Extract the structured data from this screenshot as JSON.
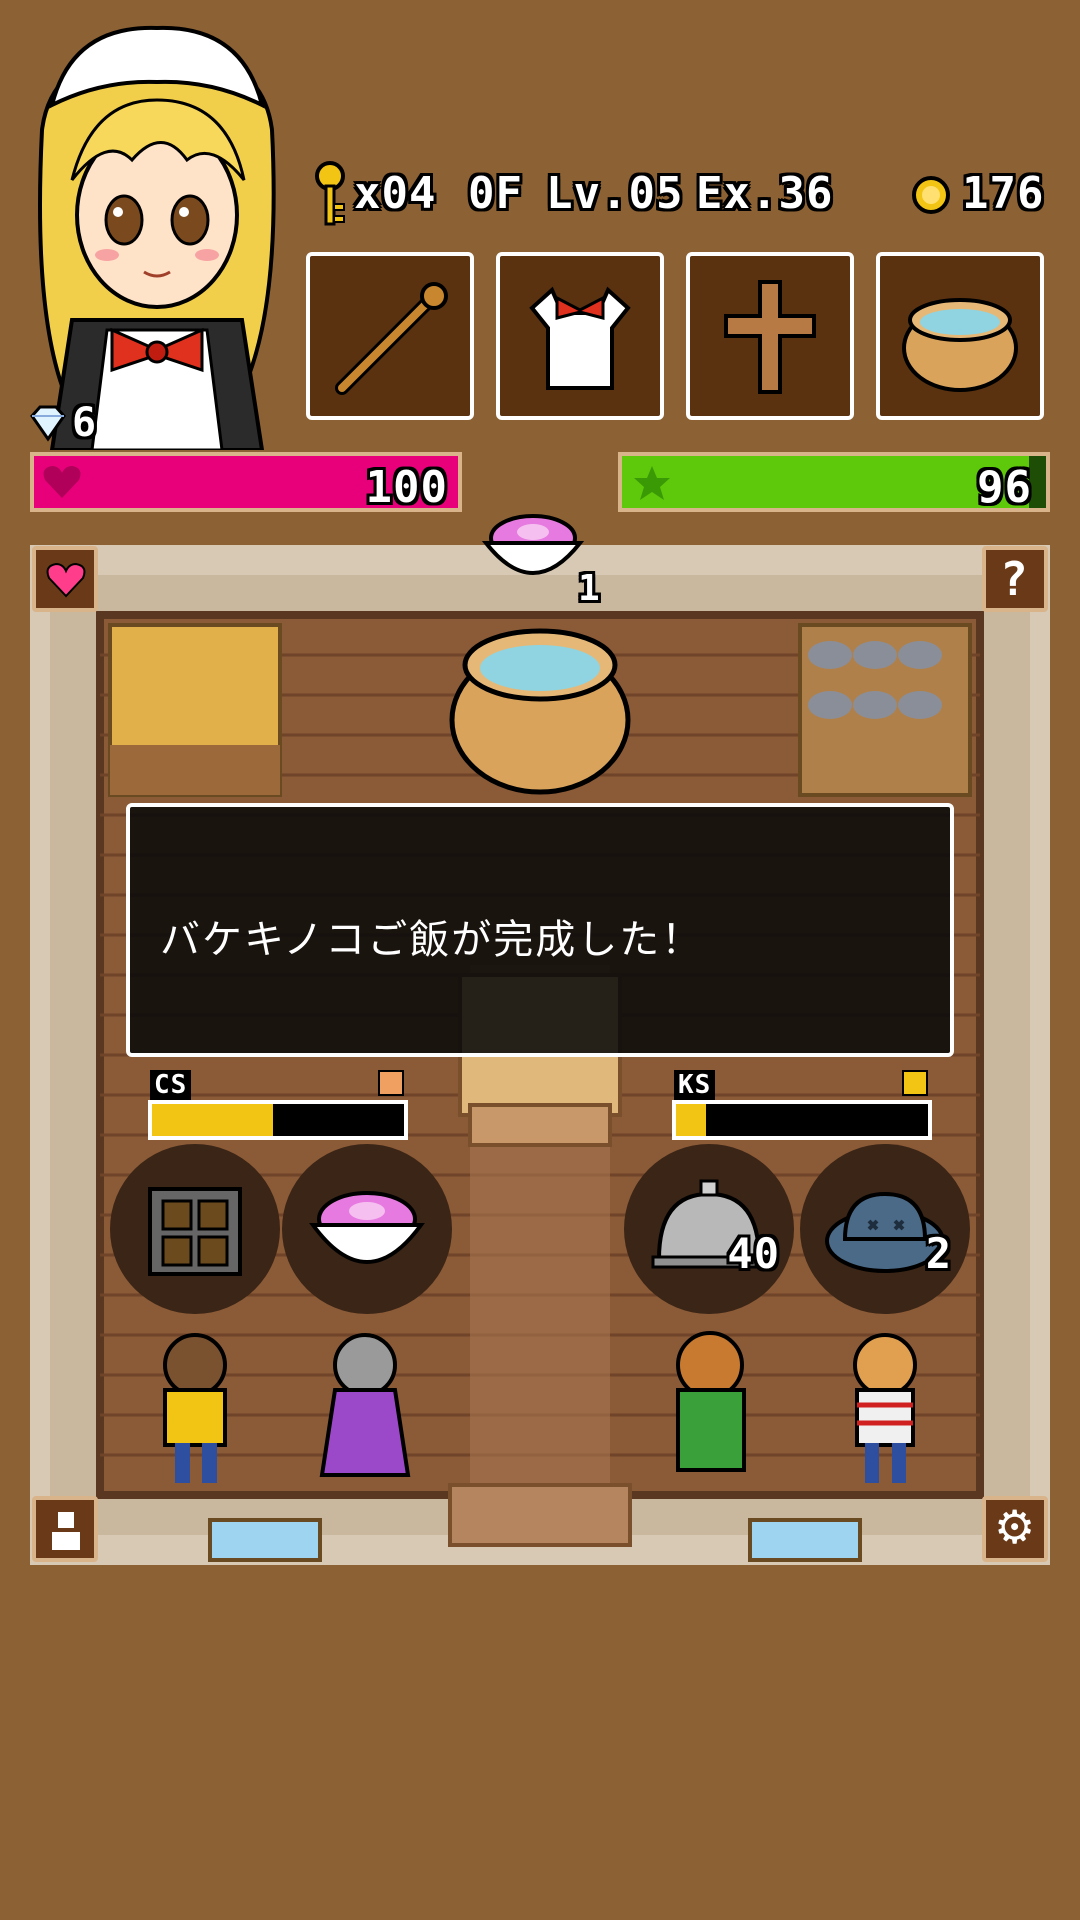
{
  "hud": {
    "keys": "x04",
    "floor": "0F",
    "level": "Lv.05",
    "exp": "Ex.36",
    "coins": "176",
    "gems": "6"
  },
  "equipment": [
    {
      "icon": "wooden-staff-icon"
    },
    {
      "icon": "maid-apron-icon"
    },
    {
      "icon": "wooden-cross-icon"
    },
    {
      "icon": "cooking-pot-icon"
    }
  ],
  "bars": {
    "health": {
      "value": "100",
      "fill": 1.0,
      "color": "#e8007a"
    },
    "stamina": {
      "value": "96",
      "fill": 0.96,
      "color": "#5ec80a"
    }
  },
  "room": {
    "current_dish_count": "1",
    "dialog_message": "バケキノコご飯が完成した！",
    "gauges": [
      {
        "label": "CS",
        "fill": 0.48
      },
      {
        "label": "KS",
        "fill": 0.12
      }
    ],
    "orders": [
      {
        "icon": "brownie-tray-icon",
        "count": ""
      },
      {
        "icon": "pink-rice-bowl-icon",
        "count": ""
      },
      {
        "icon": "silver-cloche-icon",
        "count": "40"
      },
      {
        "icon": "blue-slime-icon",
        "count": "2"
      }
    ]
  },
  "buttons": {
    "favorite_icon": "heart-icon",
    "help_icon": "question-mark-icon",
    "profile_icon": "person-icon",
    "settings_icon": "gear-icon"
  }
}
